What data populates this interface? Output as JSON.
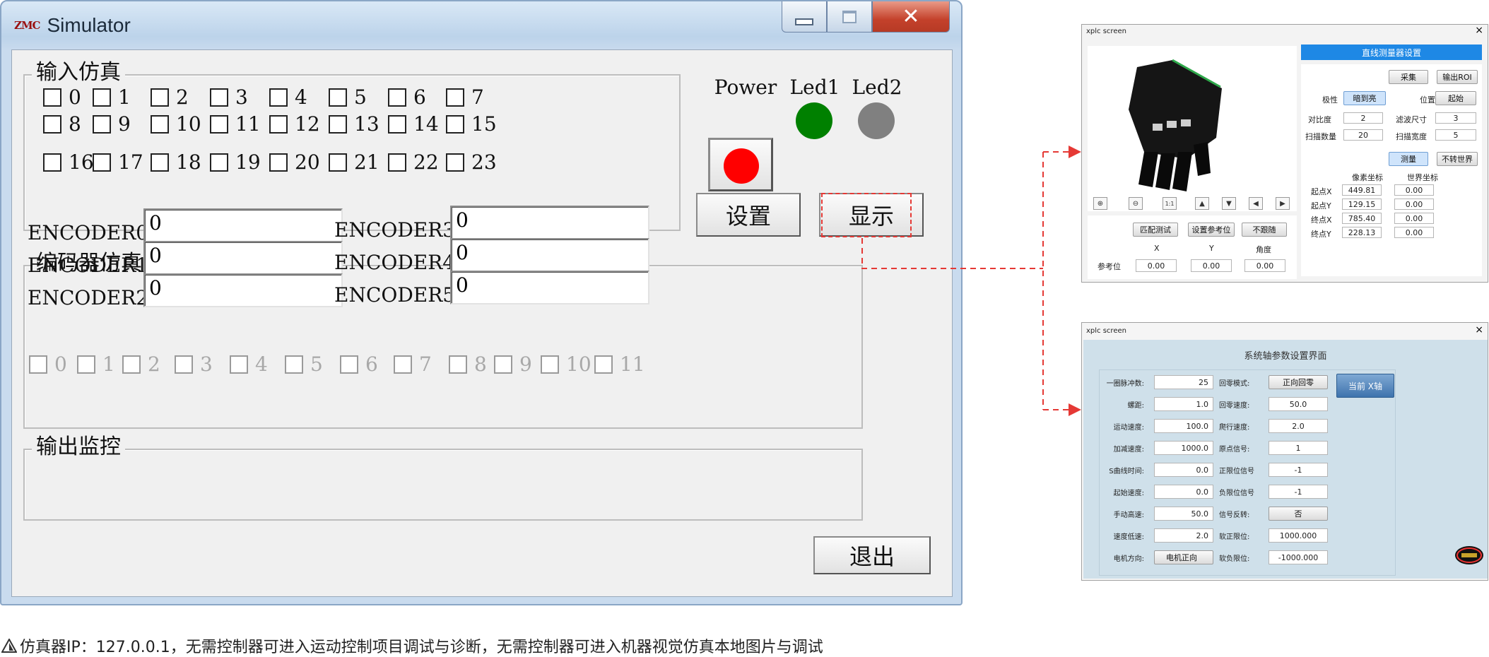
{
  "simulator": {
    "logo": "ZMC",
    "title": "Simulator",
    "input_group": {
      "title": "输入仿真",
      "inputs": [
        "0",
        "1",
        "2",
        "3",
        "4",
        "5",
        "6",
        "7",
        "8",
        "9",
        "10",
        "11",
        "12",
        "13",
        "14",
        "15",
        "16",
        "17",
        "18",
        "19",
        "20",
        "21",
        "22",
        "23"
      ]
    },
    "leds": [
      {
        "label": "Power",
        "color": "#ff0000"
      },
      {
        "label": "Led1",
        "color": "#008000"
      },
      {
        "label": "Led2",
        "color": "#808080"
      }
    ],
    "settings_label": "设置",
    "display_label": "显示",
    "encoder_group": {
      "title": "编码器仿真",
      "encoders": [
        {
          "label": "ENCODER0",
          "value": "0"
        },
        {
          "label": "ENCODER1",
          "value": "0"
        },
        {
          "label": "ENCODER2",
          "value": "0"
        },
        {
          "label": "ENCODER3",
          "value": "0"
        },
        {
          "label": "ENCODER4",
          "value": "0"
        },
        {
          "label": "ENCODER5",
          "value": "0"
        }
      ]
    },
    "output_group": {
      "title": "输出监控",
      "outputs": [
        "0",
        "1",
        "2",
        "3",
        "4",
        "5",
        "6",
        "7",
        "8",
        "9",
        "10",
        "11"
      ]
    },
    "exit_label": "退出"
  },
  "vision_panel": {
    "title": "xplc screen",
    "close": "×",
    "header": "直线测量器设置",
    "collect_label": "采集",
    "output_roi_label": "输出ROI",
    "polarity_label": "极性",
    "polarity_value": "暗到亮",
    "position_label": "位置",
    "position_value": "起始",
    "contrast_label": "对比度",
    "contrast_value": "2",
    "filter_label": "滤波尺寸",
    "filter_value": "3",
    "scan_count_label": "扫描数量",
    "scan_count_value": "20",
    "scan_width_label": "扫描宽度",
    "scan_width_value": "5",
    "measure_label": "测量",
    "no_world_label": "不转世界",
    "pixel_coord_label": "像素坐标",
    "world_coord_label": "世界坐标",
    "points": [
      {
        "label": "起点X",
        "pixel": "449.81",
        "world": "0.00"
      },
      {
        "label": "起点Y",
        "pixel": "129.15",
        "world": "0.00"
      },
      {
        "label": "终点X",
        "pixel": "785.40",
        "world": "0.00"
      },
      {
        "label": "终点Y",
        "pixel": "228.13",
        "world": "0.00"
      }
    ],
    "toolbar": [
      "zoom-in-icon",
      "zoom-out-icon",
      "fit-icon",
      "up-icon",
      "down-icon",
      "left-icon",
      "right-icon"
    ],
    "fit_text": "1:1",
    "match_test_label": "匹配测试",
    "set_ref_label": "设置参考位",
    "no_follow_label": "不跟随",
    "col_x": "X",
    "col_y": "Y",
    "col_angle": "角度",
    "ref_label": "参考位",
    "ref_values": [
      "0.00",
      "0.00",
      "0.00"
    ]
  },
  "axis_panel": {
    "title": "xplc screen",
    "close": "×",
    "heading": "系统轴参数设置界面",
    "left_rows": [
      {
        "label": "一圈脉冲数:",
        "value": "25"
      },
      {
        "label": "螺距:",
        "value": "1.0"
      },
      {
        "label": "运动速度:",
        "value": "100.0"
      },
      {
        "label": "加减速度:",
        "value": "1000.0"
      },
      {
        "label": "S曲线时间:",
        "value": "0.0"
      },
      {
        "label": "起始速度:",
        "value": "0.0"
      },
      {
        "label": "手动高速:",
        "value": "50.0"
      },
      {
        "label": "速度低速:",
        "value": "2.0"
      },
      {
        "label": "电机方向:",
        "value": "电机正向"
      }
    ],
    "right_rows": [
      {
        "label": "回零模式:",
        "value": "正向回零"
      },
      {
        "label": "回零速度:",
        "value": "50.0"
      },
      {
        "label": "爬行速度:",
        "value": "2.0"
      },
      {
        "label": "原点信号:",
        "value": "1"
      },
      {
        "label": "正限位信号",
        "value": "-1"
      },
      {
        "label": "负限位信号",
        "value": "-1"
      },
      {
        "label": "信号反转:",
        "value": "否"
      },
      {
        "label": "软正限位:",
        "value": "1000.000"
      },
      {
        "label": "软负限位:",
        "value": "-1000.000"
      }
    ],
    "current_axis_label": "当前 X轴"
  },
  "caption": "仿真器IP：127.0.0.1，无需控制器可进入运动控制项目调试与诊断，无需控制器可进入机器视觉仿真本地图片与调试",
  "colors": {
    "accent_blue": "#1e88e5",
    "annotation_red": "#e53935",
    "axis_panel_bg": "#cfe0ea"
  }
}
